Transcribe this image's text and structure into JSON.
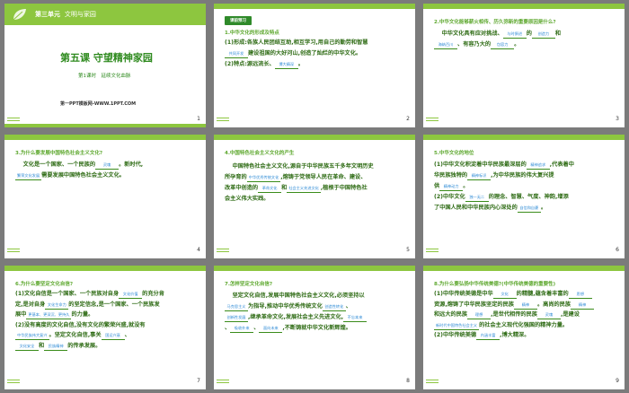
{
  "slides": [
    {
      "num": "1",
      "unit": "第三单元",
      "unit_title": "文明与家园",
      "lesson": "第五课 守望精神家园",
      "sub": "第1课时　延续文化血脉",
      "site": "第一PPT模板网-WWW.1PPT.COM"
    },
    {
      "num": "2",
      "badge": "课前预习",
      "heading": "1.中华文化的形成及特点",
      "l1a": "(1)形成:各族人民团结互助,相互学习,用自己的勤劳和智慧",
      "b1": "共同开发",
      "l1b": "建设祖国的大好河山,创造了灿烂的中华文化。",
      "l2a": "(2)特点:源远流长、",
      "b2": "博大精深",
      "l2b": "。"
    },
    {
      "num": "3",
      "heading": "2.中华文化能够薪火相传、历久弥新的重要原因是什么?",
      "l1a": "中华文化具有应对挑战、",
      "b1": "与时俱进",
      "l1b": "的",
      "b2": "创造力",
      "l1c": "和",
      "b3": "海纳百川",
      "l2a": "、",
      "l2b": "有容乃大的",
      "b4": "包容力",
      "l2c": "。"
    },
    {
      "num": "4",
      "heading": "3.为什么要发展中国特色社会主义文化?",
      "l1a": "文化是一个国家、一个民族的",
      "b1": "灵魂",
      "l1b": "。新时代,",
      "b2": "繁荣文化发展",
      "l2a": "需要发展中国特色社会主义文化。"
    },
    {
      "num": "5",
      "heading": "4.中国特色社会主义文化的产生",
      "l1": "中国特色社会主义文化,源自于中华民族五千多年文明历史",
      "l2a": "所孕育的",
      "b1": "中华优秀传统文化",
      "l2b": ",熔铸于党领导人民在革命、建设、",
      "l3a": "改革中创造的",
      "b2": "革命文化",
      "l3b": "和",
      "b3": "社会主义先进文化",
      "l3c": ",植根于中国特色社",
      "l4": "会主义伟大实践。"
    },
    {
      "num": "6",
      "heading": "5.中华文化的地位",
      "l1a": "(1)中华文化积淀着中华民族最深层的",
      "b1": "精神追求",
      "l1b": ",代表着中",
      "l2a": "华民族独特的",
      "b2": "精神标识",
      "l2b": ",为中华民族的伟大复兴提",
      "l3a": "供",
      "b3": "精神动力",
      "l3b": "。",
      "l4a": "(2)中华文化",
      "b4": "独一无二",
      "l4b": "的理念、智慧、气度、神韵,增添",
      "l5a": "了中国人民和中华民族内心深处的",
      "b5": "自信和自豪",
      "l5b": "。"
    },
    {
      "num": "7",
      "heading": "6.为什么要坚定文化自信?",
      "l1a": "(1)文化自信是一个国家、一个民族对自身",
      "b1": "文化价值",
      "l1b": "的充分肯",
      "l2a": "定,是对自身",
      "b2": "文化生命力",
      "l2b": "的坚定信念,是一个国家、一个民族发",
      "l3a": "展中",
      "b3": "更基本、更深沉、更持久",
      "l3b": "的力量。",
      "l4a": "(2)没有高度的文化自信,没有文化的繁荣兴盛,就没有",
      "l5a": "",
      "b4": "中华民族伟大复兴",
      "l5b": "。坚定文化自信,事关",
      "b5": "国运兴衰",
      "l5c": "、",
      "b6": "文化安全",
      "l6b": "和",
      "b7": "民族精神",
      "l6c": "的传承发展。"
    },
    {
      "num": "8",
      "heading": "7.怎样坚定文化自信?",
      "l1": "坚定文化自信,发展中国特色社会主义文化,必须坚持以",
      "b1": "马克思主义",
      "l2b": "为指导,推动中华优秀传统文化",
      "b2": "创造性转化",
      "l2c": "、",
      "b3": "创新性发展",
      "l3b": ",继承革命文化,发展社会主义先进文化,",
      "b4": "不忘本来",
      "l4a": "、",
      "b5": "吸收外来",
      "l4b": "、",
      "b6": "面向未来",
      "l4c": ",不断铸就中华文化新辉煌。"
    },
    {
      "num": "9",
      "heading": "8.为什么要弘扬中华传统美德?(中华传统美德的重要性)",
      "l1a": "(1)中华传统美德是中华",
      "b1": "文化",
      "l1b": "的精髓,蕴含着丰富的",
      "b1b": "思想",
      "l2a": "资源,熔铸了中华民族坚定的民族",
      "b2": "精神",
      "l2b": "。高尚的民族",
      "b3": "精神",
      "l3a": "和远大的民族",
      "b4": "理想",
      "l3b": ",是世代相传的民族",
      "b5": "灵魂",
      "l3c": ",是建设",
      "b6": "新时代中国特色社会主义",
      "l4b": "的社会主义现代化强国的精神力量。",
      "l5a": "(2)中华传统美德",
      "b7": "内涵丰富",
      "l5b": ",博大精深。"
    }
  ]
}
